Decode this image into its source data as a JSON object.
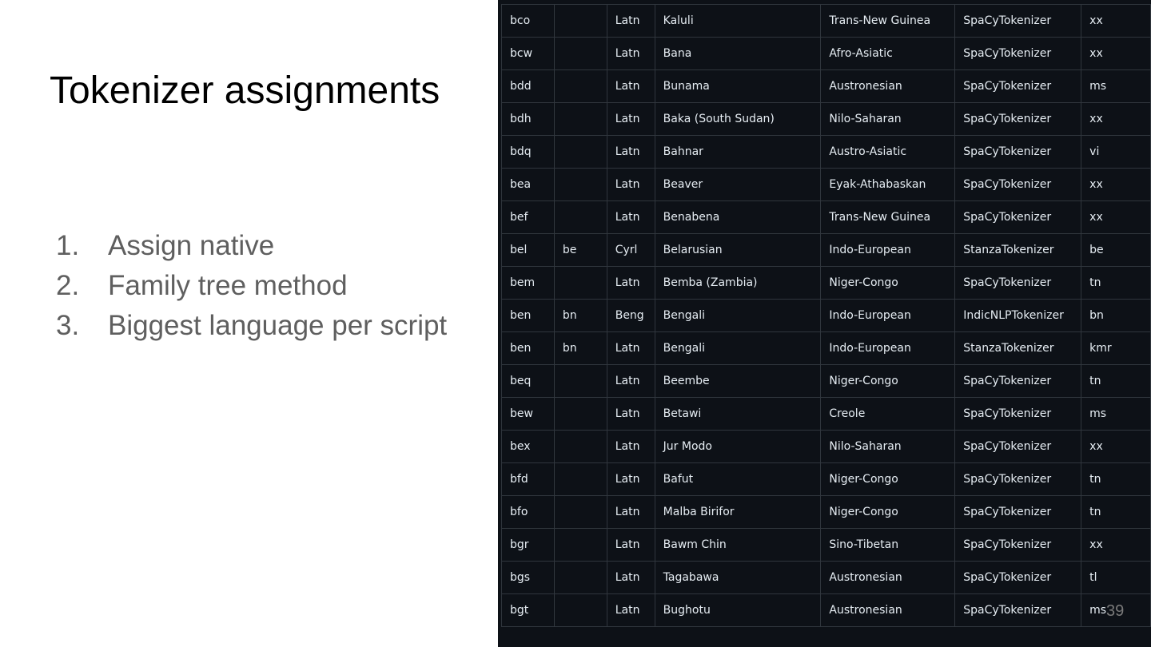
{
  "slide": {
    "title": "Tokenizer assignments",
    "steps": [
      {
        "num": "1.",
        "text": "Assign native"
      },
      {
        "num": "2.",
        "text": "Family tree method"
      },
      {
        "num": "3.",
        "text": "Biggest language per script"
      }
    ],
    "page_number": "39"
  },
  "colors": {
    "table_background": "#0d1117",
    "table_border": "#30363d",
    "table_text": "#e6edf3",
    "step_text": "#5f5f5f"
  },
  "table": {
    "rows": [
      {
        "code": "bco",
        "iso1": "",
        "script": "Latn",
        "name": "Kaluli",
        "family": "Trans-New Guinea",
        "tokenizer": "SpaCyTokenizer",
        "lang": "xx"
      },
      {
        "code": "bcw",
        "iso1": "",
        "script": "Latn",
        "name": "Bana",
        "family": "Afro-Asiatic",
        "tokenizer": "SpaCyTokenizer",
        "lang": "xx"
      },
      {
        "code": "bdd",
        "iso1": "",
        "script": "Latn",
        "name": "Bunama",
        "family": "Austronesian",
        "tokenizer": "SpaCyTokenizer",
        "lang": "ms"
      },
      {
        "code": "bdh",
        "iso1": "",
        "script": "Latn",
        "name": "Baka (South Sudan)",
        "family": "Nilo-Saharan",
        "tokenizer": "SpaCyTokenizer",
        "lang": "xx"
      },
      {
        "code": "bdq",
        "iso1": "",
        "script": "Latn",
        "name": "Bahnar",
        "family": "Austro-Asiatic",
        "tokenizer": "SpaCyTokenizer",
        "lang": "vi"
      },
      {
        "code": "bea",
        "iso1": "",
        "script": "Latn",
        "name": "Beaver",
        "family": "Eyak-Athabaskan",
        "tokenizer": "SpaCyTokenizer",
        "lang": "xx"
      },
      {
        "code": "bef",
        "iso1": "",
        "script": "Latn",
        "name": "Benabena",
        "family": "Trans-New Guinea",
        "tokenizer": "SpaCyTokenizer",
        "lang": "xx"
      },
      {
        "code": "bel",
        "iso1": "be",
        "script": "Cyrl",
        "name": "Belarusian",
        "family": "Indo-European",
        "tokenizer": "StanzaTokenizer",
        "lang": "be"
      },
      {
        "code": "bem",
        "iso1": "",
        "script": "Latn",
        "name": "Bemba (Zambia)",
        "family": "Niger-Congo",
        "tokenizer": "SpaCyTokenizer",
        "lang": "tn"
      },
      {
        "code": "ben",
        "iso1": "bn",
        "script": "Beng",
        "name": "Bengali",
        "family": "Indo-European",
        "tokenizer": "IndicNLPTokenizer",
        "lang": "bn"
      },
      {
        "code": "ben",
        "iso1": "bn",
        "script": "Latn",
        "name": "Bengali",
        "family": "Indo-European",
        "tokenizer": "StanzaTokenizer",
        "lang": "kmr"
      },
      {
        "code": "beq",
        "iso1": "",
        "script": "Latn",
        "name": "Beembe",
        "family": "Niger-Congo",
        "tokenizer": "SpaCyTokenizer",
        "lang": "tn"
      },
      {
        "code": "bew",
        "iso1": "",
        "script": "Latn",
        "name": "Betawi",
        "family": "Creole",
        "tokenizer": "SpaCyTokenizer",
        "lang": "ms"
      },
      {
        "code": "bex",
        "iso1": "",
        "script": "Latn",
        "name": "Jur Modo",
        "family": "Nilo-Saharan",
        "tokenizer": "SpaCyTokenizer",
        "lang": "xx"
      },
      {
        "code": "bfd",
        "iso1": "",
        "script": "Latn",
        "name": "Bafut",
        "family": "Niger-Congo",
        "tokenizer": "SpaCyTokenizer",
        "lang": "tn"
      },
      {
        "code": "bfo",
        "iso1": "",
        "script": "Latn",
        "name": "Malba Birifor",
        "family": "Niger-Congo",
        "tokenizer": "SpaCyTokenizer",
        "lang": "tn"
      },
      {
        "code": "bgr",
        "iso1": "",
        "script": "Latn",
        "name": "Bawm Chin",
        "family": "Sino-Tibetan",
        "tokenizer": "SpaCyTokenizer",
        "lang": "xx"
      },
      {
        "code": "bgs",
        "iso1": "",
        "script": "Latn",
        "name": "Tagabawa",
        "family": "Austronesian",
        "tokenizer": "SpaCyTokenizer",
        "lang": "tl"
      },
      {
        "code": "bgt",
        "iso1": "",
        "script": "Latn",
        "name": "Bughotu",
        "family": "Austronesian",
        "tokenizer": "SpaCyTokenizer",
        "lang": "ms"
      }
    ]
  }
}
